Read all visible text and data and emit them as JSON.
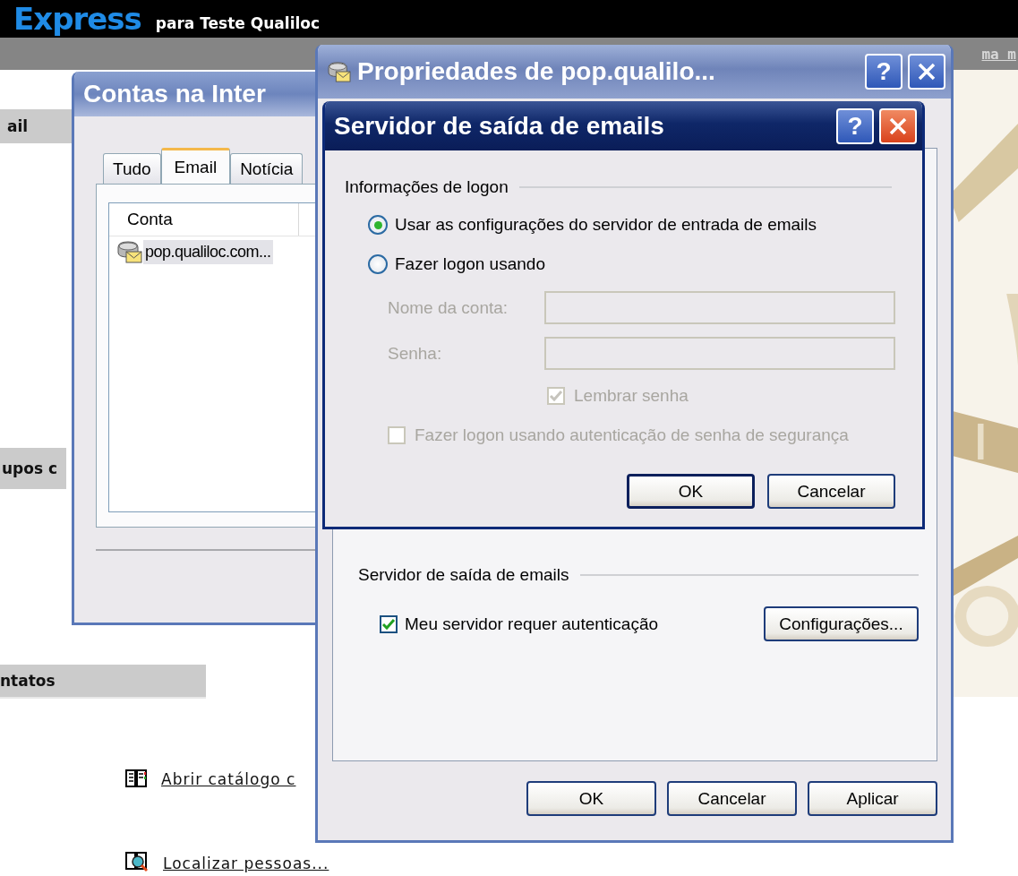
{
  "page": {
    "brand": "Express",
    "subtitle": "para Teste Qualiloc",
    "nav_link": "ma m",
    "sections": [
      {
        "title": "ail"
      },
      {
        "title": "upos c"
      },
      {
        "title": "ntatos"
      }
    ],
    "links": [
      {
        "label": "Abrir catálogo c",
        "kind": "book"
      },
      {
        "label": "Localizar pessoas...",
        "kind": "find"
      }
    ]
  },
  "accounts_window": {
    "title": "Contas na Inter",
    "tabs": [
      {
        "label": "Tudo",
        "selected": false
      },
      {
        "label": "Email",
        "selected": true
      },
      {
        "label": "Notícia",
        "selected": false
      }
    ],
    "columns": [
      "Conta"
    ],
    "rows": [
      {
        "account": "pop.qualiloc.com...",
        "selected": true
      }
    ]
  },
  "properties_window": {
    "title": "Propriedades de pop.qualilo...",
    "help": "?",
    "group_title": "Servidor de saída de emails",
    "auth": {
      "label": "Meu servidor requer autenticação",
      "checked": true
    },
    "settings_button": "Configurações...",
    "buttons": [
      "OK",
      "Cancelar",
      "Aplicar"
    ]
  },
  "outgoing_dialog": {
    "title": "Servidor de saída de emails",
    "help": "?",
    "group_title": "Informações de logon",
    "options": [
      {
        "label": "Usar as configurações do servidor de entrada de emails",
        "selected": true
      },
      {
        "label": "Fazer logon usando",
        "selected": false
      }
    ],
    "fields": [
      {
        "label": "Nome da conta:",
        "disabled": true
      },
      {
        "label": "Senha:",
        "disabled": true
      }
    ],
    "remember": {
      "label": "Lembrar senha",
      "checked": true,
      "disabled": true
    },
    "spa": {
      "label": "Fazer logon usando autenticação de senha de segurança",
      "checked": false,
      "disabled": true
    },
    "buttons": [
      {
        "label": "OK",
        "default": true
      },
      {
        "label": "Cancelar",
        "default": false
      }
    ]
  }
}
